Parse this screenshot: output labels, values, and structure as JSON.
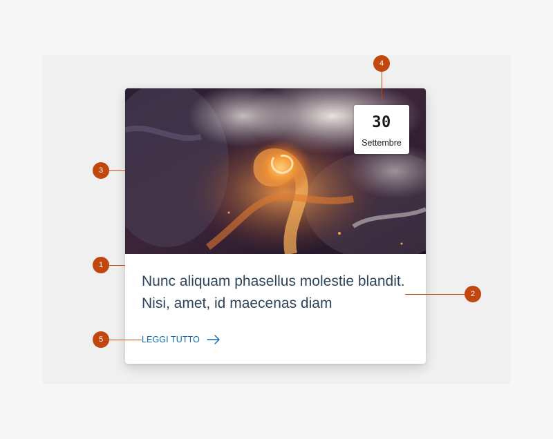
{
  "card": {
    "date": {
      "day": "30",
      "month": "Settembre"
    },
    "title": "Nunc aliquam phasellus molestie blandit. Nisi, amet, id maecenas diam",
    "read_more": "LEGGI TUTTO",
    "read_more_icon": "arrow-right-icon",
    "image": "abstract-fluid-art-image"
  },
  "annotations": [
    "1",
    "2",
    "3",
    "4",
    "5"
  ],
  "colors": {
    "accent": "#c1470f",
    "link": "#0b6ab0",
    "title": "#2f455c",
    "panel": "#f0f0f0",
    "page": "#f6f6f6"
  }
}
